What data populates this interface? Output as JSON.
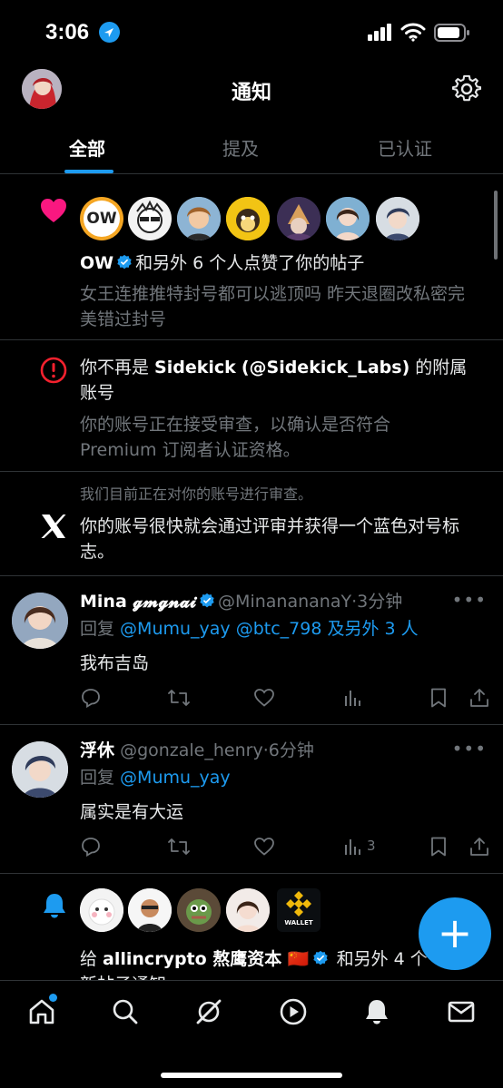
{
  "status_bar": {
    "time": "3:06"
  },
  "header": {
    "title": "通知"
  },
  "tabs": [
    {
      "label": "全部",
      "active": true
    },
    {
      "label": "提及",
      "active": false
    },
    {
      "label": "已认证",
      "active": false
    }
  ],
  "notifications": {
    "like": {
      "icon": "heart-icon",
      "avatar_badge": "OW",
      "actor": "OW",
      "action": "和另外 6 个人点赞了你的帖子",
      "post_text": "女王连推推特封号都可以逃顶吗 昨天退圈改私密完美错过封号"
    },
    "affiliation": {
      "icon": "alert-circle-icon",
      "title_prefix": "你不再是 ",
      "org_name": "Sidekick",
      "org_handle": "(@Sidekick_Labs)",
      "title_suffix": " 的附属账号",
      "body": "你的账号正在接受审查，以确认是否符合 Premium 订阅者认证资格。"
    },
    "review": {
      "icon": "x-logo-icon",
      "pre": "我们目前正在对你的账号进行审查。",
      "body": "你的账号很快就会通过评审并获得一个蓝色对号标志。"
    },
    "reply1": {
      "name": "Mina 𝓰𝓶𝓰𝓷𝓪𝓲",
      "handle": "@MinanananaY",
      "time": "·3分钟",
      "reply_prefix": "回复 ",
      "reply_to": "@Mumu_yay @btc_798 及另外 3 人",
      "text": "我布吉岛",
      "views": ""
    },
    "reply2": {
      "name": "浮休",
      "handle": "@gonzale_henry",
      "time": "·6分钟",
      "reply_prefix": "回复 ",
      "reply_to": "@Mumu_yay",
      "text": "属实是有大运",
      "views": "3"
    },
    "subscribe": {
      "icon": "bell-icon",
      "wallet_label": "WALLET",
      "prefix": "给 ",
      "name": "allincrypto 熬鹰资本 🇨🇳",
      "suffix": " 和另外 4 个",
      "line2": "新帖子通知"
    }
  },
  "colors": {
    "accent": "#1d9bf0",
    "like": "#f91880",
    "alert": "#f4212e",
    "muted": "#71767b"
  }
}
